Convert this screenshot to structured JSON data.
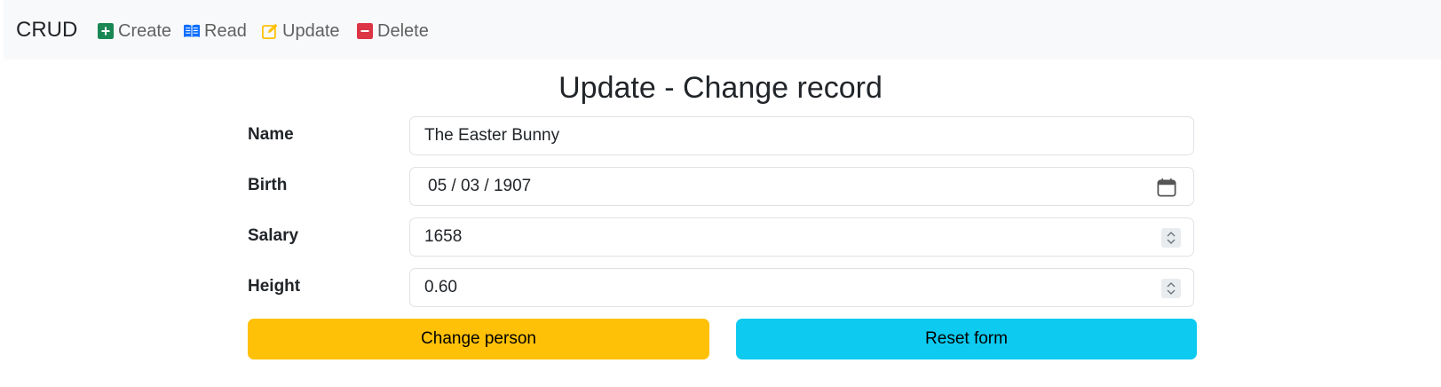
{
  "navbar": {
    "brand": "CRUD",
    "items": [
      {
        "label": "Create",
        "icon": "plus-square-icon",
        "color": "#198754"
      },
      {
        "label": "Read",
        "icon": "book-icon",
        "color": "#0d6efd"
      },
      {
        "label": "Update",
        "icon": "pencil-square-icon",
        "color": "#ffc107"
      },
      {
        "label": "Delete",
        "icon": "minus-square-icon",
        "color": "#dc3545"
      }
    ]
  },
  "page": {
    "title": "Update - Change record"
  },
  "form": {
    "name_label": "Name",
    "name_value": "The Easter Bunny",
    "birth_label": "Birth",
    "birth_value": "05 / 03 / 1907",
    "salary_label": "Salary",
    "salary_value": "1658",
    "height_label": "Height",
    "height_value": "0.60"
  },
  "buttons": {
    "submit_label": "Change person",
    "submit_color": "#ffc107",
    "reset_label": "Reset form",
    "reset_color": "#0dcaf0"
  }
}
